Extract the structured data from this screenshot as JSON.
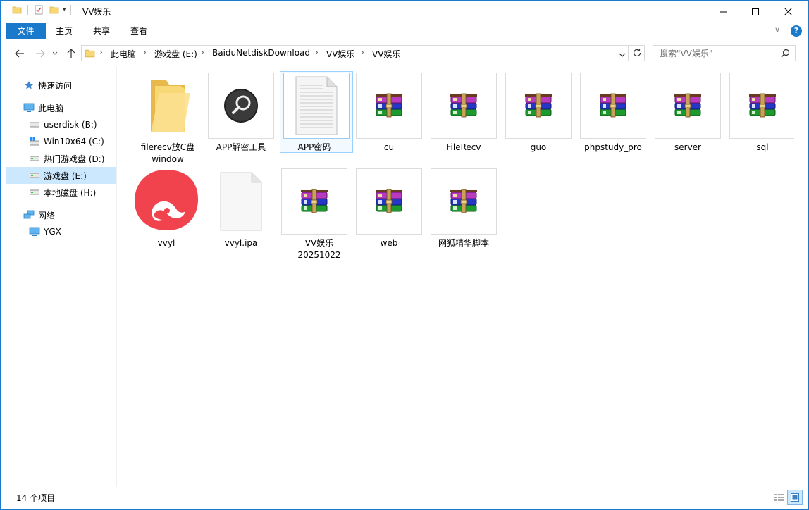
{
  "window": {
    "title": "VV娱乐"
  },
  "ribbon": {
    "tabs": [
      "文件",
      "主页",
      "共享",
      "查看"
    ]
  },
  "address": {
    "crumbs": [
      "此电脑",
      "游戏盘 (E:)",
      "BaiduNetdiskDownload",
      "VV娱乐",
      "VV娱乐"
    ],
    "search_placeholder": "搜索\"VV娱乐\""
  },
  "sidebar": {
    "items": [
      {
        "label": "快速访问",
        "icon": "star-icon"
      },
      {
        "label": "此电脑",
        "icon": "computer-icon"
      },
      {
        "label": "userdisk (B:)",
        "icon": "drive-icon"
      },
      {
        "label": "Win10x64 (C:)",
        "icon": "windows-drive-icon"
      },
      {
        "label": "热门游戏盘 (D:)",
        "icon": "drive-icon"
      },
      {
        "label": "游戏盘 (E:)",
        "icon": "drive-icon"
      },
      {
        "label": "本地磁盘 (H:)",
        "icon": "drive-icon"
      },
      {
        "label": "网络",
        "icon": "network-icon"
      },
      {
        "label": "YGX",
        "icon": "monitor-icon"
      }
    ]
  },
  "files": [
    {
      "label": "filerecv放C盘window",
      "type": "folder"
    },
    {
      "label": "APP解密工具",
      "type": "exe"
    },
    {
      "label": "APP密码",
      "type": "text",
      "selected": true
    },
    {
      "label": "cu",
      "type": "rar"
    },
    {
      "label": "FileRecv",
      "type": "rar"
    },
    {
      "label": "guo",
      "type": "rar"
    },
    {
      "label": "phpstudy_pro",
      "type": "rar"
    },
    {
      "label": "server",
      "type": "rar"
    },
    {
      "label": "sql",
      "type": "rar"
    },
    {
      "label": "vvyl",
      "type": "app"
    },
    {
      "label": "vvyl.ipa",
      "type": "blank"
    },
    {
      "label": "VV娱乐20251022",
      "type": "rar"
    },
    {
      "label": "web",
      "type": "rar"
    },
    {
      "label": "网狐精华脚本",
      "type": "rar"
    }
  ],
  "status": {
    "count": "14 个项目"
  },
  "colors": {
    "accent": "#1979ca",
    "selection": "#cce8ff",
    "folder": "#f8d775",
    "app_red": "#f0434d"
  }
}
